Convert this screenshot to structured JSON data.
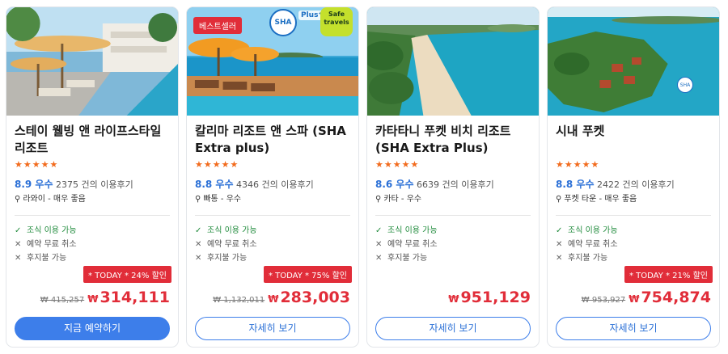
{
  "colors": {
    "accent_blue": "#3d7eea",
    "discount_red": "#e12d39",
    "star_orange": "#f26b1d",
    "feature_green": "#1f8a3b"
  },
  "cards": [
    {
      "title": "스테이 웰빙 앤 라이프스타일 리조트",
      "stars": "★★★★★",
      "score": "8.9 우수",
      "reviews": "2375 건의 이용후기",
      "location": "라와이 - 매우 좋음",
      "features": [
        "조식 이용 가능",
        "예약 무료 취소",
        "후지불 가능"
      ],
      "discount": "* TODAY * 24% 할인",
      "old_price": "₩ 415,257",
      "currency": "₩",
      "price": "314,111",
      "button": "지금 예약하기"
    },
    {
      "badge": "베스트셀러",
      "sha_text": "SHA",
      "sha_plus": "Plus⁺",
      "safe_travels": "Safe travels",
      "title": "칼리마 리조트 앤 스파 (SHA Extra plus)",
      "stars": "★★★★★",
      "score": "8.8 우수",
      "reviews": "4346 건의 이용후기",
      "location": "빠통 - 우수",
      "features": [
        "조식 이용 가능",
        "예약 무료 취소",
        "후지불 가능"
      ],
      "discount": "* TODAY * 75% 할인",
      "old_price": "₩ 1,132,011",
      "currency": "₩",
      "price": "283,003",
      "button": "자세히 보기"
    },
    {
      "title": "카타타니 푸켓 비치 리조트 (SHA Extra Plus)",
      "stars": "★★★★★",
      "score": "8.6 우수",
      "reviews": "6639 건의 이용후기",
      "location": "카타 - 우수",
      "features": [
        "조식 이용 가능",
        "예약 무료 취소",
        "후지불 가능"
      ],
      "currency": "₩",
      "price": "951,129",
      "button": "자세히 보기"
    },
    {
      "title": "시내 푸켓",
      "stars": "★★★★★",
      "score": "8.8 우수",
      "reviews": "2422 건의 이용후기",
      "location": "푸켓 타운 - 매우 좋음",
      "features": [
        "조식 이용 가능",
        "예약 무료 취소",
        "후지불 가능"
      ],
      "discount": "* TODAY * 21% 할인",
      "old_price": "₩ 953,927",
      "currency": "₩",
      "price": "754,874",
      "button": "자세히 보기"
    }
  ]
}
